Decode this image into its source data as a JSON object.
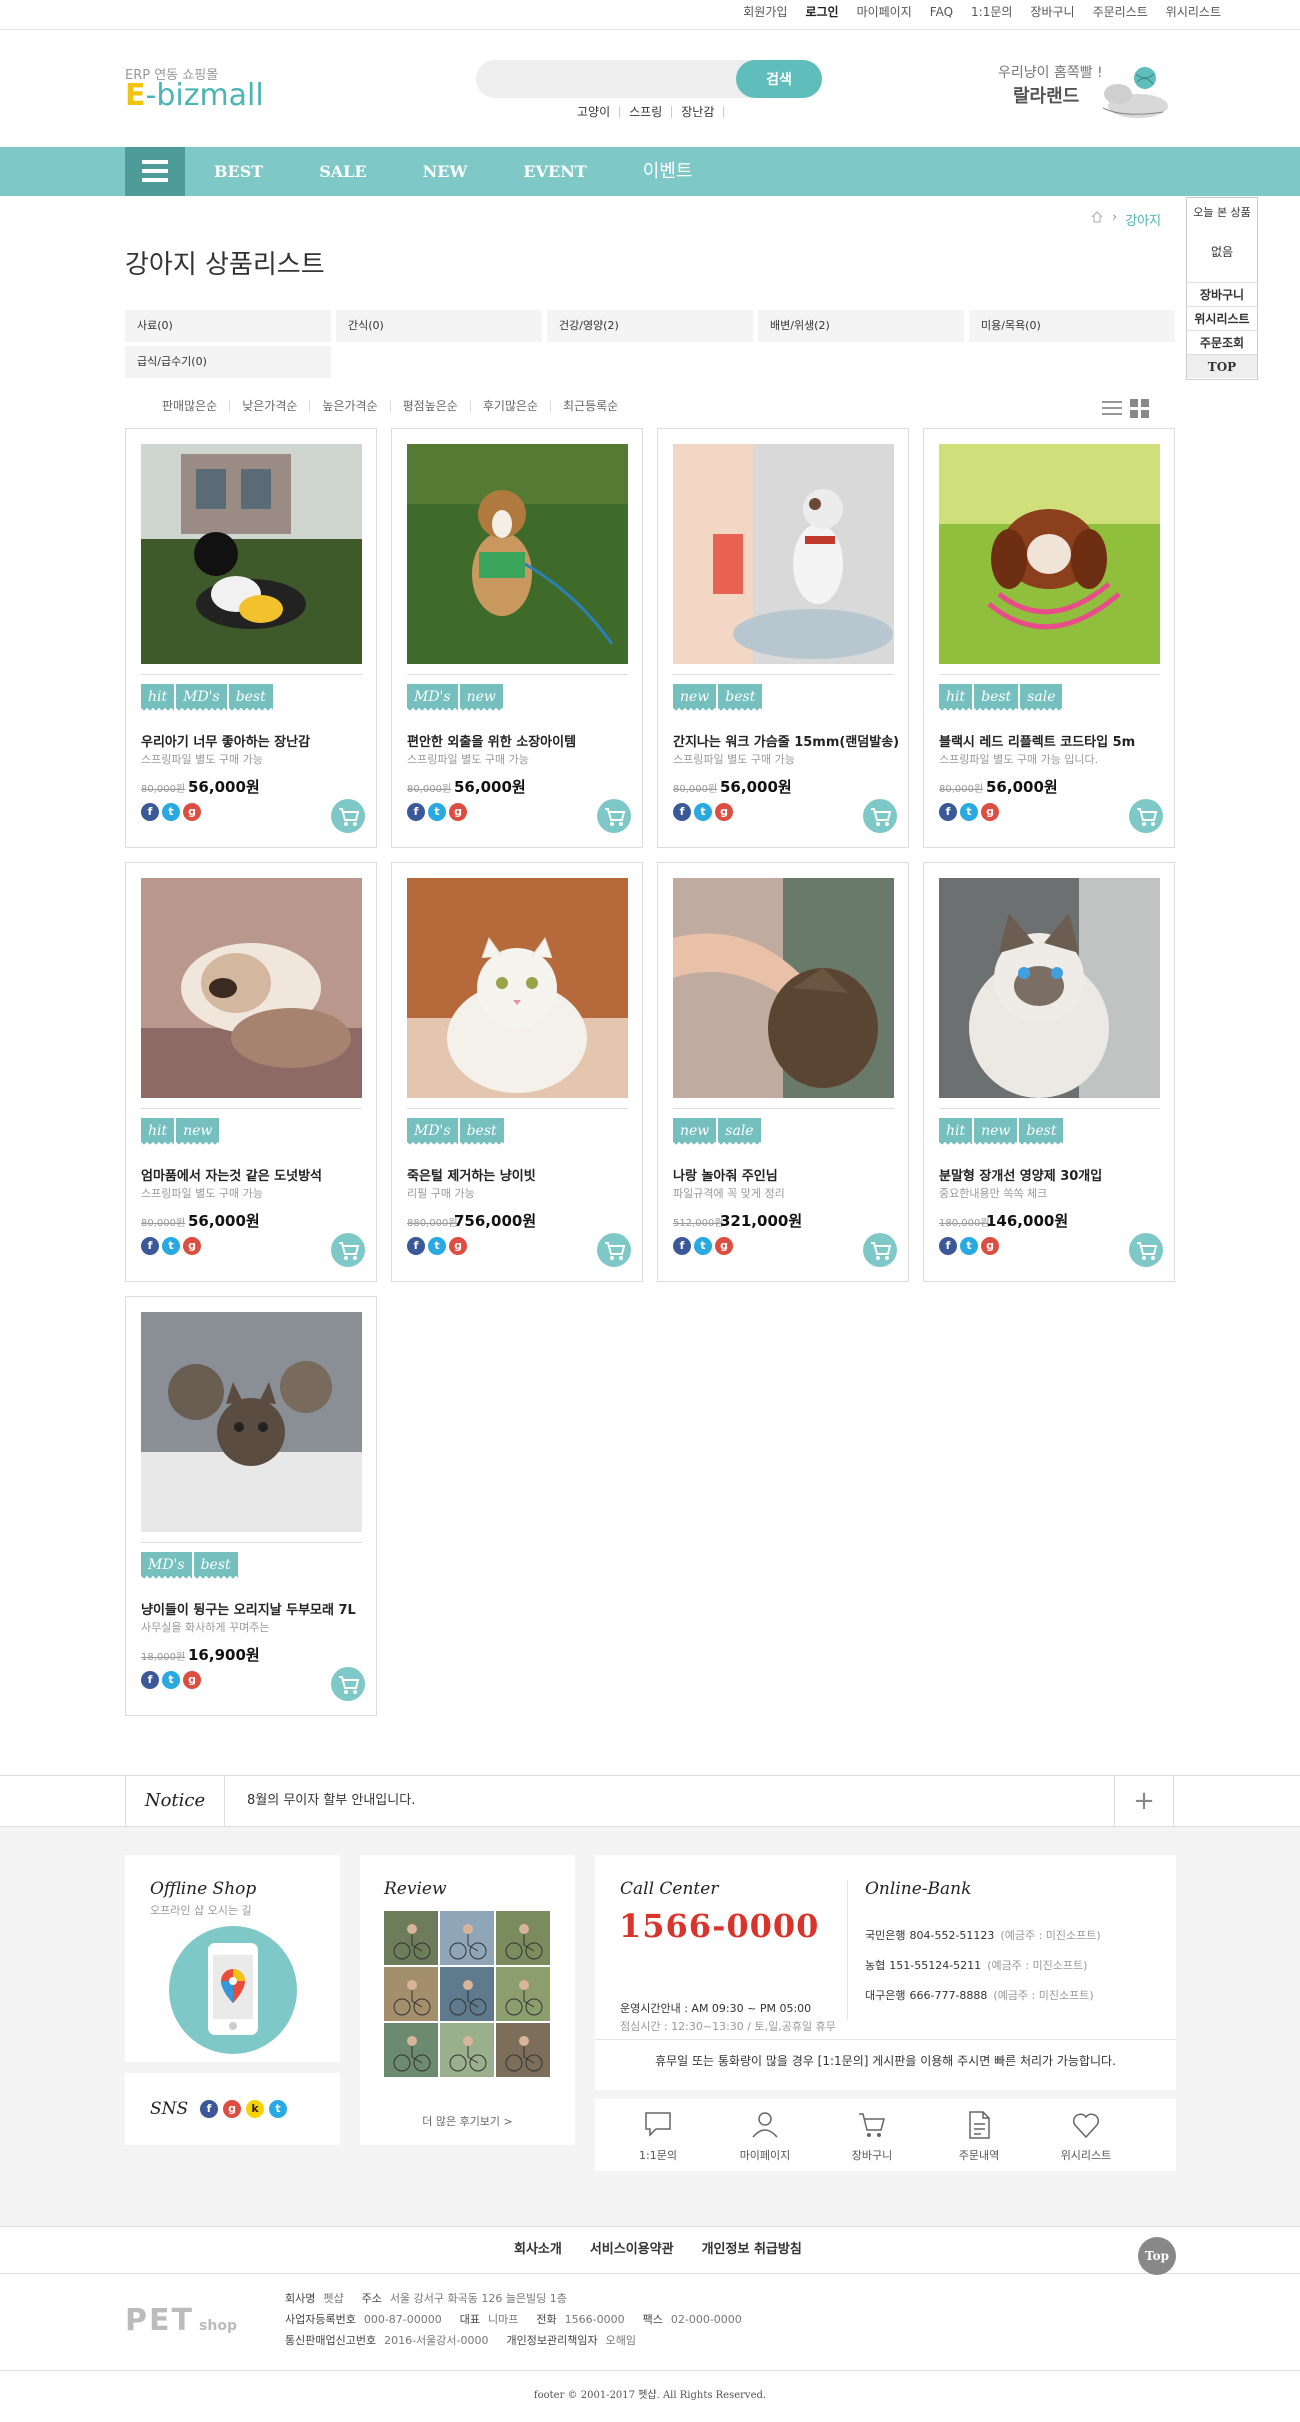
{
  "topbar": [
    "회원가입",
    "로그인",
    "마이페이지",
    "FAQ",
    "1:1문의",
    "장바구니",
    "주문리스트",
    "위시리스트"
  ],
  "logo": {
    "sub": "ERP 연동 쇼핑몰",
    "main_e": "E",
    "main_rest": "-bizmall"
  },
  "search": {
    "placeholder": "",
    "button": "검색",
    "keywords": [
      "고양이",
      "스프링",
      "장난감"
    ]
  },
  "brand_ad": {
    "line1": "우리냥이 홈쪽빨 !",
    "line2": "랄라랜드"
  },
  "nav": [
    "BEST",
    "SALE",
    "NEW",
    "EVENT",
    "이벤트"
  ],
  "breadcrumb": {
    "current": "강아지"
  },
  "page_title": "강아지 상품리스트",
  "categories": [
    "사료(0)",
    "간식(0)",
    "건강/영양(2)",
    "배변/위생(2)",
    "미용/목욕(0)",
    "급식/급수기(0)"
  ],
  "sorts": [
    "판매많은순",
    "낮은가격순",
    "높은가격순",
    "평점높은순",
    "후기많은순",
    "최근등록순"
  ],
  "products": [
    {
      "badges": [
        "hit",
        "MD's",
        "best"
      ],
      "name": "우리아기 너무 좋아하는 장난감",
      "desc": "스프링파일 별도 구매 가능",
      "old": "80,000원",
      "price": "56,000원"
    },
    {
      "badges": [
        "MD's",
        "new"
      ],
      "name": "편안한 외출을 위한 소장아이템",
      "desc": "스프링파일 별도 구매 가능",
      "old": "80,000원",
      "price": "56,000원"
    },
    {
      "badges": [
        "new",
        "best"
      ],
      "name": "간지나는 워크 가슴줄 15mm(랜덤발송)",
      "desc": "스프링파일 별도 구매 가능",
      "old": "80,000원",
      "price": "56,000원"
    },
    {
      "badges": [
        "hit",
        "best",
        "sale"
      ],
      "name": "블랙시 레드 리플렉트 코드타입 5m",
      "desc": "스프링파일 별도 구매 가능 입니다.",
      "old": "80,000원",
      "price": "56,000원"
    },
    {
      "badges": [
        "hit",
        "new"
      ],
      "name": "엄마품에서 자는것 같은 도넛방석",
      "desc": "스프링파일 별도 구매 가능",
      "old": "80,000원",
      "price": "56,000원"
    },
    {
      "badges": [
        "MD's",
        "best"
      ],
      "name": "죽은털 제거하는 냥이빗",
      "desc": "리필 구매 가능",
      "old": "880,000원",
      "price": "756,000원"
    },
    {
      "badges": [
        "new",
        "sale"
      ],
      "name": "나랑 놀아줘 주인님",
      "desc": "파일규격에 꼭 맞게 정리",
      "old": "512,000원",
      "price": "321,000원"
    },
    {
      "badges": [
        "hit",
        "new",
        "best"
      ],
      "name": "분말형 장개선 영양제 30개입",
      "desc": "중요한내용만 쏙쏙 체크",
      "old": "180,000원",
      "price": "146,000원"
    },
    {
      "badges": [
        "MD's",
        "best"
      ],
      "name": "냥이들이 뒹구는 오리지날 두부모래 7L",
      "desc": "사무실을 화사하게 꾸며주는",
      "old": "18,000원",
      "price": "16,900원"
    }
  ],
  "quick": {
    "header": "오늘 본 상품",
    "empty": "없음",
    "items": [
      "장바구니",
      "위시리스트",
      "주문조회",
      "TOP"
    ]
  },
  "notice": {
    "label": "Notice",
    "text": "8월의 무이자 할부 안내입니다.",
    "plus": "+"
  },
  "offline": {
    "title": "Offline Shop",
    "sub": "오프라인 샵 오시는 길"
  },
  "sns": {
    "title": "SNS"
  },
  "review": {
    "title": "Review",
    "more": "더 많은 후기보기 >"
  },
  "callcenter": {
    "title": "Call Center",
    "number": "1566-0000",
    "hours": "운영시간안내 : AM 09:30 ~ PM 05:00",
    "lunch": "점심시간 : 12:30~13:30 / 토,일,공휴일 휴무"
  },
  "bank": {
    "title": "Online-Bank",
    "accounts": [
      {
        "bank": "국민은행",
        "num": "804-552-51123",
        "owner": "(예금주 : 미진소프트)"
      },
      {
        "bank": "농협",
        "num": "151-55124-5211",
        "owner": "(예금주 : 미진소프트)"
      },
      {
        "bank": "대구은행",
        "num": "666-777-8888",
        "owner": "(예금주 : 미진소프트)"
      }
    ]
  },
  "cs_note": "휴무일 또는 통화량이 많을 경우 [1:1문의] 게시판을 이용해 주시면 빠른 처리가 가능합니다.",
  "shortcuts": [
    "1:1문의",
    "마이페이지",
    "장바구니",
    "주문내역",
    "위시리스트"
  ],
  "bottom_links": [
    "회사소개",
    "서비스이용약관",
    "개인정보 취급방침"
  ],
  "top_button": "Top",
  "footer_logo": {
    "main": "PET",
    "sub": "shop"
  },
  "company": {
    "line1": [
      {
        "k": "회사명",
        "v": "펫샵"
      },
      {
        "k": "주소",
        "v": "서울 강서구 화곡동 126 늘은빌딩 1층"
      }
    ],
    "line2": [
      {
        "k": "사업자등록번호",
        "v": "000-87-00000"
      },
      {
        "k": "대표",
        "v": "니마프"
      },
      {
        "k": "전화",
        "v": "1566-0000"
      },
      {
        "k": "팩스",
        "v": "02-000-0000"
      }
    ],
    "line3": [
      {
        "k": "통신판매업신고번호",
        "v": "2016-서울강서-0000"
      },
      {
        "k": "개인정보관리책임자",
        "v": "오해임"
      }
    ]
  },
  "copyright": "footer © 2001-2017 펫샵. All Rights Reserved.",
  "colors": {
    "accent": "#7ec8c7",
    "accent_dark": "#4e9c9a",
    "price_red": "#d9342b"
  }
}
